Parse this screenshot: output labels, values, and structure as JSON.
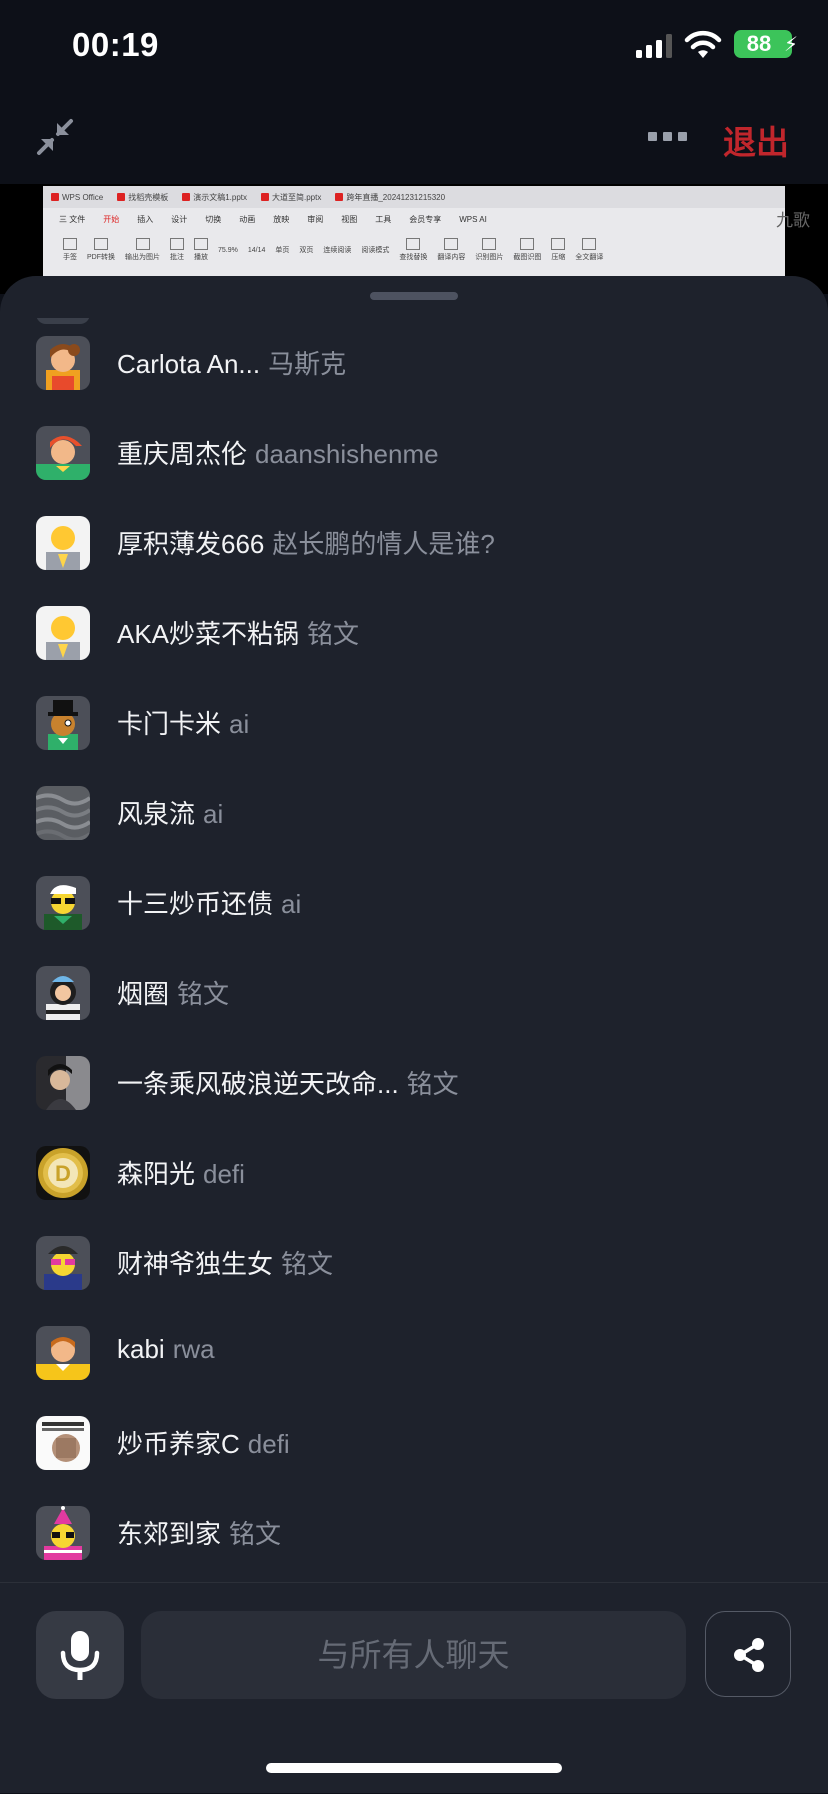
{
  "status": {
    "time": "00:19",
    "battery": "88"
  },
  "header": {
    "exit_label": "退出"
  },
  "screen_share": {
    "tabs": [
      "WPS Office",
      "找稻壳模板",
      "演示文稿1.pptx",
      "大道至简.pptx",
      "跨年直播_20241231215320"
    ],
    "menu": [
      "三 文件",
      "开始",
      "插入",
      "设计",
      "切换",
      "动画",
      "放映",
      "审阅",
      "视图",
      "工具",
      "会员专享",
      "WPS AI"
    ],
    "tools": [
      "手签",
      "PDF转换",
      "输出为图片",
      "批注",
      "播放",
      "75.9%",
      "14/14",
      "单页",
      "双页",
      "连续阅读",
      "阅读模式",
      "查找替换",
      "翻译内容",
      "识别图片",
      "截图识图",
      "压缩",
      "全文翻译"
    ],
    "side_text": "九歌"
  },
  "participants": [
    {
      "name": "Carlota An...",
      "message": "马斯克"
    },
    {
      "name": "重庆周杰伦",
      "message": "daanshishenme"
    },
    {
      "name": "厚积薄发666",
      "message": "赵长鹏的情人是谁?"
    },
    {
      "name": "AKA炒菜不粘锅",
      "message": "铭文"
    },
    {
      "name": "卡门卡米",
      "message": "ai"
    },
    {
      "name": "风泉流",
      "message": "ai"
    },
    {
      "name": "十三炒币还债",
      "message": "ai"
    },
    {
      "name": "烟圈",
      "message": "铭文"
    },
    {
      "name": "一条乘风破浪逆天改命...",
      "message": "铭文"
    },
    {
      "name": "森阳光",
      "message": "defi"
    },
    {
      "name": "财神爷独生女",
      "message": "铭文"
    },
    {
      "name": "kabi",
      "message": "rwa"
    },
    {
      "name": "炒币养家C",
      "message": "defi"
    },
    {
      "name": "东郊到家",
      "message": "铭文"
    }
  ],
  "chat": {
    "placeholder": "与所有人聊天"
  },
  "colors": {
    "accent_red": "#c0262c",
    "sheet_bg": "#1e222c",
    "battery_green": "#3cc45a"
  }
}
